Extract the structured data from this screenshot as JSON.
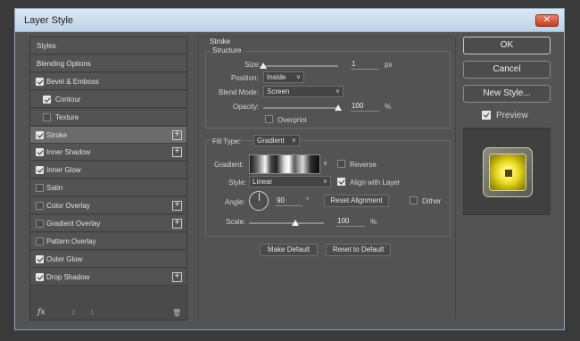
{
  "window": {
    "title": "Layer Style",
    "close_glyph": "✕"
  },
  "left_panel": {
    "items": [
      {
        "label": "Styles",
        "checkbox": null,
        "plus": false,
        "selected": false
      },
      {
        "label": "Blending Options",
        "checkbox": null,
        "plus": false,
        "selected": false
      },
      {
        "label": "Bevel & Emboss",
        "checkbox": true,
        "plus": false,
        "selected": false
      },
      {
        "label": "Contour",
        "checkbox": true,
        "plus": false,
        "selected": false,
        "sub": true
      },
      {
        "label": "Texture",
        "checkbox": false,
        "plus": false,
        "selected": false,
        "sub": true
      },
      {
        "label": "Stroke",
        "checkbox": true,
        "plus": true,
        "selected": true
      },
      {
        "label": "Inner Shadow",
        "checkbox": true,
        "plus": true,
        "selected": false
      },
      {
        "label": "Inner Glow",
        "checkbox": true,
        "plus": false,
        "selected": false
      },
      {
        "label": "Satin",
        "checkbox": false,
        "plus": false,
        "selected": false
      },
      {
        "label": "Color Overlay",
        "checkbox": false,
        "plus": true,
        "selected": false
      },
      {
        "label": "Gradient Overlay",
        "checkbox": false,
        "plus": true,
        "selected": false
      },
      {
        "label": "Pattern Overlay",
        "checkbox": false,
        "plus": false,
        "selected": false
      },
      {
        "label": "Outer Glow",
        "checkbox": true,
        "plus": false,
        "selected": false
      },
      {
        "label": "Drop Shadow",
        "checkbox": true,
        "plus": true,
        "selected": false
      }
    ],
    "footer": {
      "fx_label": "fx"
    }
  },
  "stroke": {
    "section_title": "Stroke",
    "structure_title": "Structure",
    "size_label": "Size:",
    "size_value": "1",
    "size_unit": "px",
    "size_fraction": 0.0,
    "position_label": "Position:",
    "position_value": "Inside",
    "blend_mode_label": "Blend Mode:",
    "blend_mode_value": "Screen",
    "opacity_label": "Opacity:",
    "opacity_value": "100",
    "opacity_unit": "%",
    "opacity_fraction": 1.0,
    "overprint_label": "Overprint",
    "overprint_checked": false,
    "fill_type_label": "Fill Type:",
    "fill_type_value": "Gradient",
    "gradient_label": "Gradient:",
    "reverse_label": "Reverse",
    "reverse_checked": false,
    "style_label": "Style:",
    "style_value": "Linear",
    "align_label": "Align with Layer",
    "align_checked": true,
    "angle_label": "Angle:",
    "angle_value": "90",
    "angle_unit": "°",
    "reset_alignment_label": "Reset Alignment",
    "dither_label": "Dither",
    "dither_checked": false,
    "scale_label": "Scale:",
    "scale_value": "100",
    "scale_unit": "%",
    "scale_fraction": 0.62,
    "make_default_label": "Make Default",
    "reset_default_label": "Reset to Default"
  },
  "right_panel": {
    "ok_label": "OK",
    "cancel_label": "Cancel",
    "new_style_label": "New Style...",
    "preview_label": "Preview",
    "preview_checked": true
  }
}
